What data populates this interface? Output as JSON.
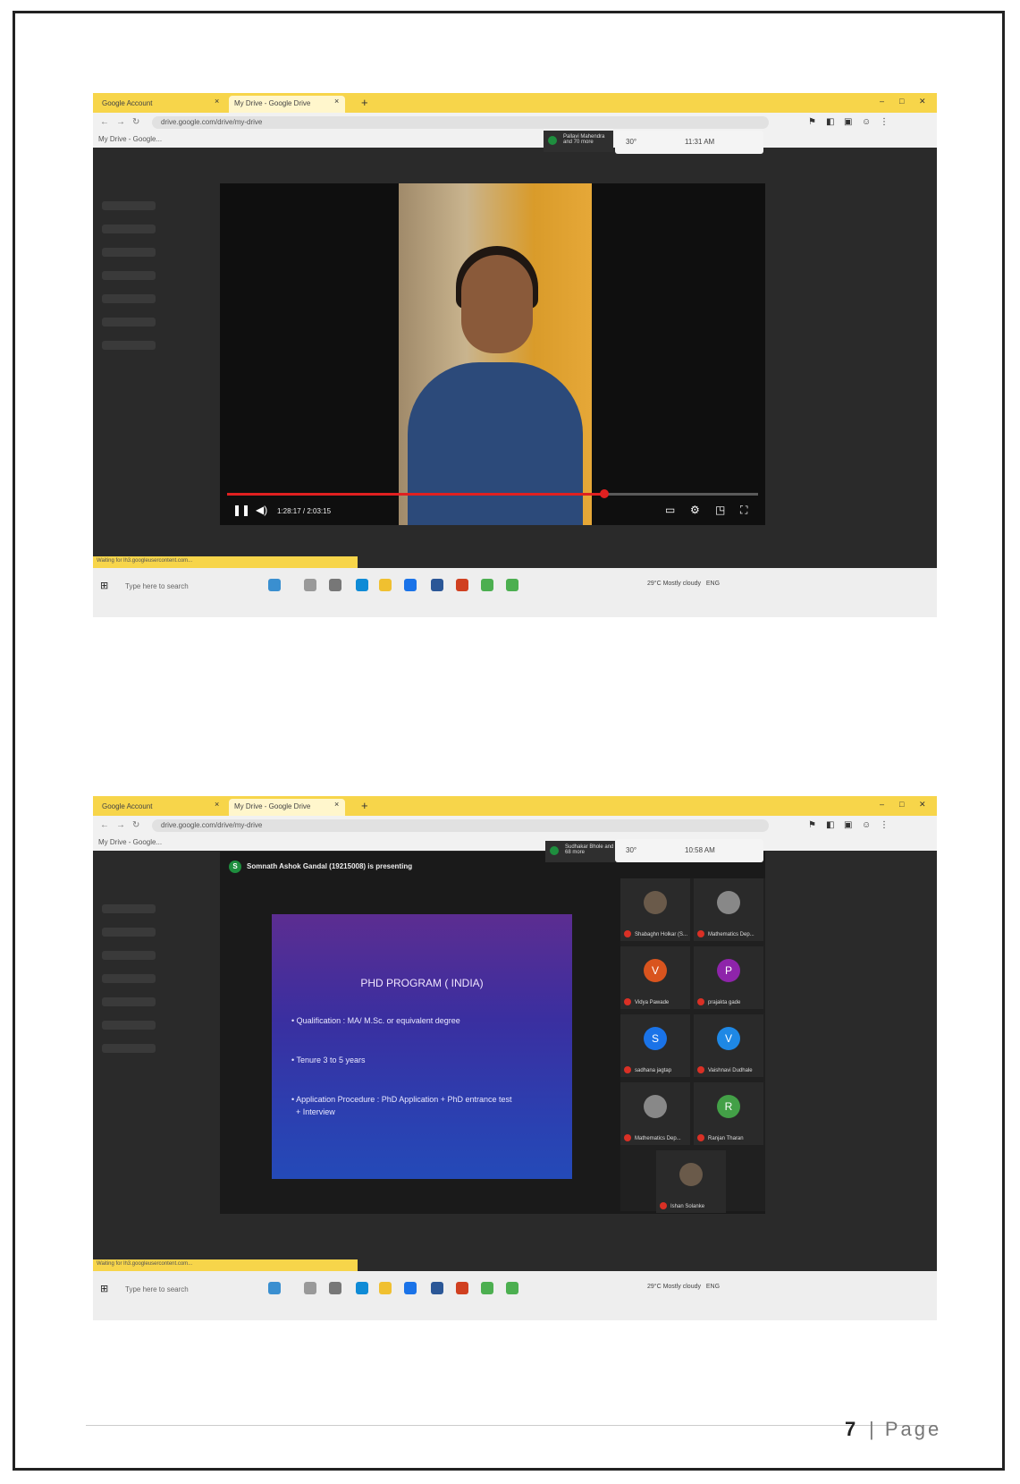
{
  "screenshots": [
    {
      "tabs": [
        "Google Account",
        "My Drive - Google Drive"
      ],
      "url": "drive.google.com/drive/my-drive",
      "bookmark": "My Drive - Google...",
      "overlay": {
        "temp": "30°",
        "time": "11:31 AM"
      },
      "sharing": "Pallavi Mahendra and 70 more",
      "video_time": "1:28:17 / 2:03:15",
      "progress": 0.71,
      "status_url": "Waiting for lh3.googleusercontent.com...",
      "taskbar": {
        "search": "Type here to search",
        "weather": "29°C Mostly cloudy",
        "lang": "ENG"
      }
    },
    {
      "tabs": [
        "Google Account",
        "My Drive - Google Drive"
      ],
      "url": "drive.google.com/drive/my-drive",
      "bookmark": "My Drive - Google...",
      "overlay": {
        "temp": "30°",
        "time": "10:58 AM"
      },
      "sharing": "Sudhakar Bhole and 68 more",
      "presenter": "Somnath Ashok Gandal (19215008) is presenting",
      "status_url": "Waiting for lh3.googleusercontent.com...",
      "slide": {
        "title": "PHD PROGRAM ( INDIA)",
        "bullets": [
          "• Qualification : MA/ M.Sc. or equivalent degree",
          "• Tenure            3 to 5 years",
          "• Application Procedure : PhD Application + PhD entrance test",
          "  + Interview"
        ]
      },
      "participants": [
        {
          "initial": "",
          "name": "Shabaghn Holkar (S...",
          "color": "#6a5a4a"
        },
        {
          "initial": "",
          "name": "Mathematics Dep...",
          "color": "#888888"
        },
        {
          "initial": "V",
          "name": "Vidya Pawade",
          "color": "#d9541e"
        },
        {
          "initial": "P",
          "name": "prajakta gade",
          "color": "#8e24aa"
        },
        {
          "initial": "S",
          "name": "sadhana jagtap",
          "color": "#1a73e8"
        },
        {
          "initial": "V",
          "name": "Vaishnavi Dudhale",
          "color": "#1e88e5"
        },
        {
          "initial": "",
          "name": "Mathematics Dep...",
          "color": "#888888"
        },
        {
          "initial": "R",
          "name": "Ranjan Tharan",
          "color": "#43a047"
        },
        {
          "initial": "",
          "name": "Ishan Solanke",
          "color": "#6a5a4a"
        }
      ],
      "taskbar": {
        "search": "Type here to search",
        "weather": "29°C Mostly cloudy",
        "lang": "ENG"
      }
    }
  ],
  "footer": {
    "page_number": "7",
    "separator": "|",
    "page_word": "Page"
  }
}
